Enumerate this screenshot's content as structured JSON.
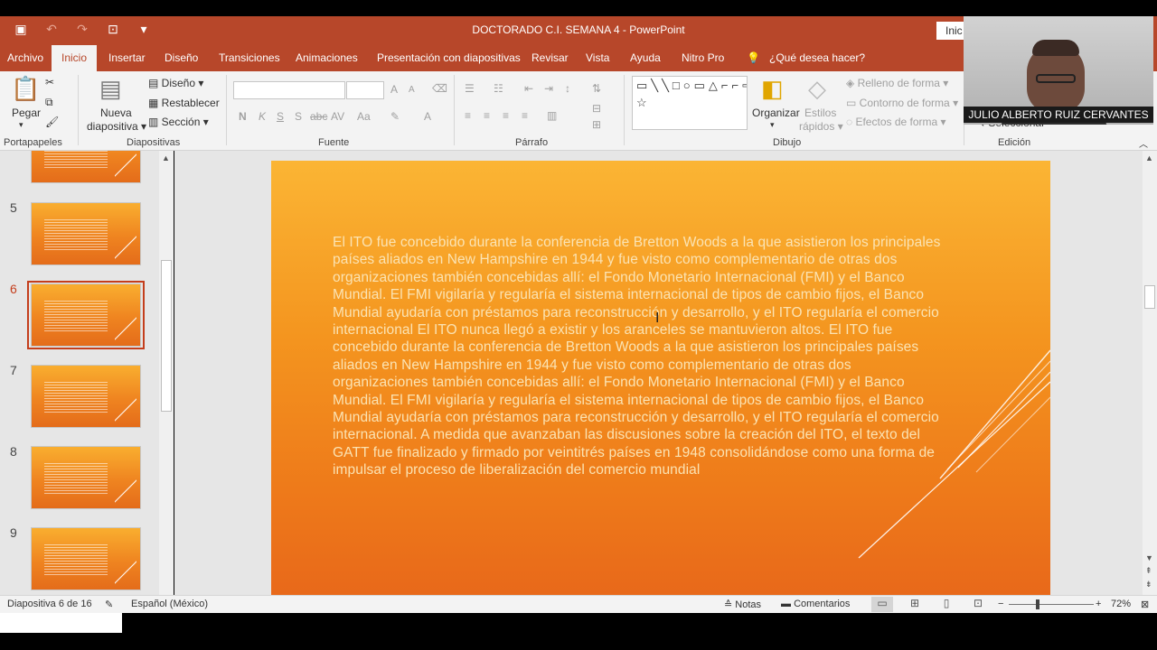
{
  "window": {
    "title": "DOCTORADO C.I. SEMANA 4  -  PowerPoint",
    "signin": "Inic"
  },
  "qat": [
    {
      "icon": "save-icon",
      "glyph": "▣"
    },
    {
      "icon": "undo-icon",
      "glyph": "↶"
    },
    {
      "icon": "redo-icon",
      "glyph": "↷"
    },
    {
      "icon": "present-from-start-icon",
      "glyph": "⊡"
    },
    {
      "icon": "customize-qat-icon",
      "glyph": "▾"
    }
  ],
  "tabs": [
    "Archivo",
    "Inicio",
    "Insertar",
    "Diseño",
    "Transiciones",
    "Animaciones",
    "Presentación con diapositivas",
    "Revisar",
    "Vista",
    "Ayuda",
    "Nitro Pro"
  ],
  "tell_me": "¿Qué desea hacer?",
  "ribbon": {
    "portapapeles": {
      "label": "Portapapeles",
      "paste": "Pegar"
    },
    "diapositivas": {
      "label": "Diapositivas",
      "new_slide_1": "Nueva",
      "new_slide_2": "diapositiva",
      "layout": "Diseño",
      "reset": "Restablecer",
      "section": "Sección"
    },
    "fuente": {
      "label": "Fuente",
      "bold": "N",
      "italic": "K",
      "underline": "S",
      "shadow": "S",
      "strike": "abc",
      "spacing": "AV",
      "case": "Aa",
      "font_color": "A",
      "grow": "A",
      "shrink": "A"
    },
    "parrafo": {
      "label": "Párrafo"
    },
    "dibujo": {
      "label": "Dibujo",
      "shapes": "▭╲╲□○▭△⌐⌐⇨⇩⬠↯⌒⌒{}☆",
      "arrange": "Organizar",
      "quick_styles_1": "Estilos",
      "quick_styles_2": "rápidos",
      "fill": "Relleno de forma",
      "outline": "Contorno de forma",
      "effects": "Efectos de forma"
    },
    "edicion": {
      "label": "Edición",
      "select": "Seleccionar"
    }
  },
  "webcam": {
    "name": "JULIO ALBERTO RUIZ CERVANTES"
  },
  "thumbnails": [
    {
      "num": "5"
    },
    {
      "num": "6",
      "selected": true
    },
    {
      "num": "7"
    },
    {
      "num": "8"
    },
    {
      "num": "9"
    }
  ],
  "slide": {
    "text": "El ITO fue concebido durante la conferencia de Bretton Woods a la que asistieron los principales países aliados en New Hampshire en 1944 y fue visto como complementario de otras dos organizaciones también concebidas allí: el Fondo Monetario Internacional (FMI) y el Banco Mundial. El FMI vigilaría y regularía el sistema internacional de tipos de cambio fijos, el Banco Mundial ayudaría con préstamos para reconstrucción y desarrollo, y el ITO regularía el comercio internacional El ITO nunca llegó a existir y los aranceles se mantuvieron altos. El ITO fue concebido durante la conferencia de Bretton Woods a la que asistieron los principales países aliados en New Hampshire en 1944 y fue visto como complementario de otras dos organizaciones también concebidas allí: el Fondo Monetario Internacional (FMI) y el Banco Mundial. El FMI vigilaría y regularía el sistema internacional de tipos de cambio fijos, el Banco Mundial ayudaría con préstamos para reconstrucción y desarrollo, y el ITO regularía el comercio internacional. A medida que avanzaban las discusiones sobre la creación del ITO, el texto del GATT fue finalizado y firmado por veintitrés países en 1948 consolidándose como una forma de impulsar el proceso de liberalización del comercio mundial"
  },
  "status": {
    "slide_of": "Diapositiva 6 de 16",
    "language": "Español (México)",
    "notes": "Notas",
    "comments": "Comentarios",
    "zoom": "72%"
  }
}
